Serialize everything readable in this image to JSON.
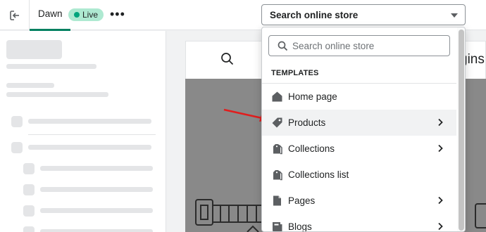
{
  "topbar": {
    "theme_name": "Dawn",
    "status_badge": "Live",
    "more_label": "•••",
    "template_select": "Search online store"
  },
  "preview": {
    "heading_fragment": "gins"
  },
  "dropdown": {
    "search_placeholder": "Search online store",
    "section_title": "TEMPLATES",
    "items": [
      {
        "label": "Home page",
        "icon": "home-icon",
        "has_submenu": false
      },
      {
        "label": "Products",
        "icon": "tag-icon",
        "has_submenu": true
      },
      {
        "label": "Collections",
        "icon": "collections-icon",
        "has_submenu": true
      },
      {
        "label": "Collections list",
        "icon": "collections-list-icon",
        "has_submenu": false
      },
      {
        "label": "Pages",
        "icon": "page-icon",
        "has_submenu": true
      },
      {
        "label": "Blogs",
        "icon": "blog-icon",
        "has_submenu": true
      }
    ]
  },
  "colors": {
    "accent": "#008060",
    "live_badge": "#aee9d1",
    "annotation_arrow": "#e11d1d"
  }
}
